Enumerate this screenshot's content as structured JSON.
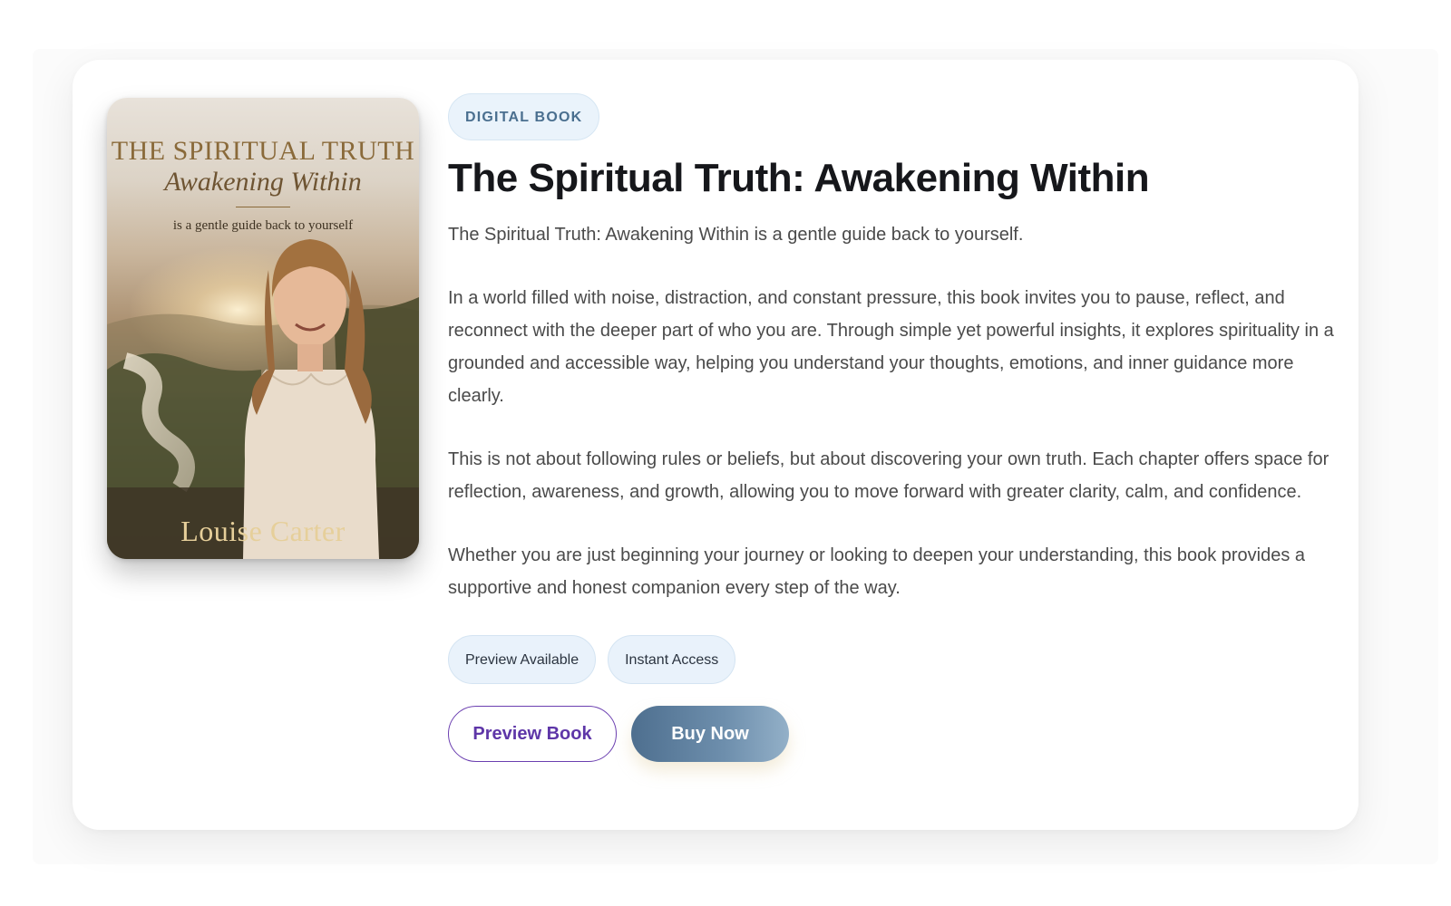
{
  "product": {
    "badge": "DIGITAL BOOK",
    "title": "The Spiritual Truth: Awakening Within",
    "description": [
      "The Spiritual Truth: Awakening Within is a gentle guide back to yourself.",
      "In a world filled with noise, distraction, and constant pressure, this book invites you to pause, reflect, and reconnect with the deeper part of who you are. Through simple yet powerful insights, it explores spirituality in a grounded and accessible way, helping you understand your thoughts, emotions, and inner guidance more clearly.",
      "This is not about following rules or beliefs, but about discovering your own truth. Each chapter offers space for reflection, awareness, and growth, allowing you to move forward with greater clarity, calm, and confidence.",
      "Whether you are just beginning your journey or looking to deepen your understanding, this book provides a supportive and honest companion every step of the way."
    ],
    "features": [
      "Preview Available",
      "Instant Access"
    ],
    "actions": {
      "preview_label": "Preview Book",
      "buy_label": "Buy Now"
    }
  },
  "cover": {
    "title": "THE SPIRITUAL TRUTH",
    "subtitle": "Awakening Within",
    "tagline": "is a gentle guide back to yourself",
    "author": "Louise Carter"
  },
  "colors": {
    "badge_text": "#4a6f8f",
    "badge_bg": "#eaf3fb",
    "preview_accent": "#5e36a8",
    "buy_gradient_start": "#4e6f8f",
    "buy_gradient_end": "#93b0c8"
  }
}
